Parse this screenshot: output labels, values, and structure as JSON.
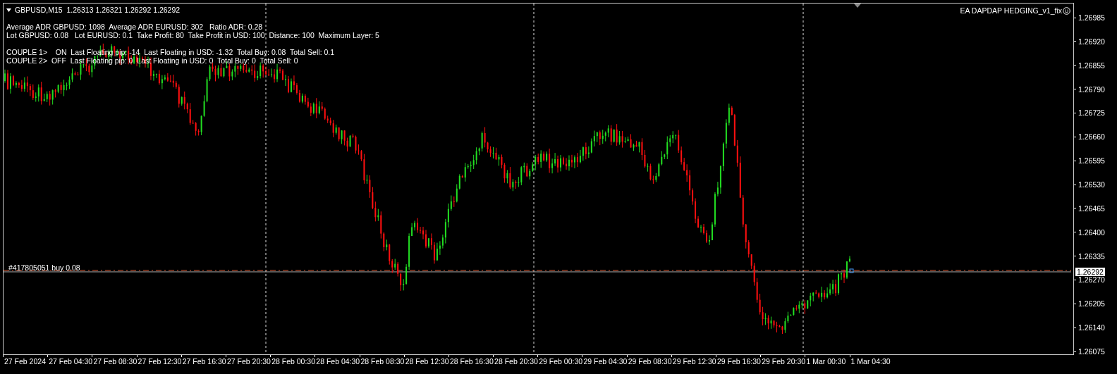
{
  "chart": {
    "symbol_line": "GBPUSD,M15  1.26313 1.26321 1.26292 1.26292",
    "expert_name": "EA DAPDAP HEDGING_v1_fix",
    "info_groups": [
      [
        "Average ADR GBPUSD: 1098  Average ADR EURUSD: 302   Ratio ADR: 0.28",
        "Lot GBPUSD: 0.08   Lot EURUSD: 0.1  Take Profit: 80  Take Profit in USD: 100  Distance: 100  Maximum Layer: 5"
      ],
      [
        "COUPLE 1>    ON  Last Floating pip: -14  Last Floating in USD: -1.32  Total Buy: 0.08  Total Sell: 0.1",
        "COUPLE 2>  OFF  Last Floating pip: 0  Last Floating in USD: 0  Total Buy: 0  Total Sell: 0"
      ]
    ],
    "order_label": "#417805051 buy 0.08",
    "price_ticks": [
      "1.26985",
      "1.26920",
      "1.26855",
      "1.26790",
      "1.26725",
      "1.26660",
      "1.26595",
      "1.26530",
      "1.26465",
      "1.26400",
      "1.26335",
      "1.26270",
      "1.26205",
      "1.26140",
      "1.26075"
    ],
    "current_price": "1.26292",
    "time_labels": [
      "27 Feb 2024",
      "27 Feb 04:30",
      "27 Feb 08:30",
      "27 Feb 12:30",
      "27 Feb 16:30",
      "27 Feb 20:30",
      "28 Feb 00:30",
      "28 Feb 04:30",
      "28 Feb 08:30",
      "28 Feb 12:30",
      "28 Feb 16:30",
      "28 Feb 20:30",
      "29 Feb 00:30",
      "29 Feb 04:30",
      "29 Feb 08:30",
      "29 Feb 12:30",
      "29 Feb 16:30",
      "29 Feb 20:30",
      "1 Mar 00:30",
      "1 Mar 04:30"
    ]
  }
}
